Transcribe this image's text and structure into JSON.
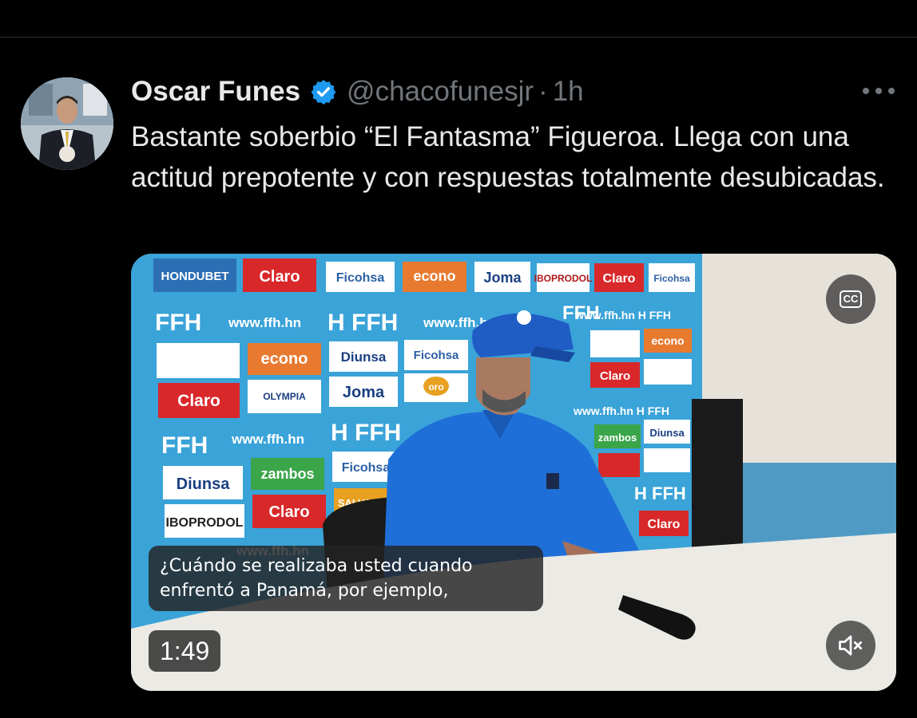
{
  "tweet": {
    "display_name": "Oscar Funes",
    "handle": "@chacofunesjr",
    "separator": "·",
    "time": "1h",
    "text": "Bastante soberbio “El Fantasma” Figueroa. Llega con una actitud prepotente y con respuestas totalmente desubicadas.",
    "verified_color": "#1d9bf0",
    "more_icon": "more-horizontal-icon"
  },
  "media": {
    "cc_label": "CC",
    "subtitle_lines": [
      "¿Cuándo se realizaba usted cuando",
      "enfrentó a Panamá, por ejemplo,"
    ],
    "duration": "1:49",
    "mute_icon": "volume-muted-icon"
  },
  "backdrop": {
    "sponsors": [
      "HONDUBET",
      "Claro",
      "Ficohsa",
      "econo",
      "Joma",
      "IBOPRODOL",
      "FFH",
      "www.ffh.hn",
      "Diunsa",
      "zambos",
      "oro",
      "SALVAVIDA",
      "OLYMPIA"
    ]
  },
  "colors": {
    "background": "#000000",
    "text": "#e7e9ea",
    "muted": "#71767b",
    "backdrop_blue": "#3aa3d8",
    "claro_red": "#d8282a",
    "shirt_blue": "#1f6fd8"
  }
}
